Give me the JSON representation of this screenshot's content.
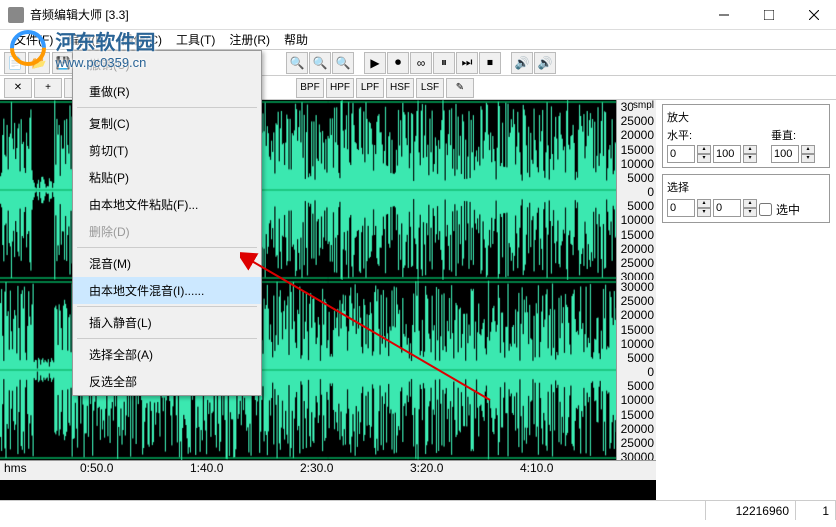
{
  "title": "音频编辑大师 [3.3]",
  "watermark": {
    "name": "河东软件园",
    "url": "www.pc0359.cn"
  },
  "menubar": [
    "文件(F)",
    "编辑(E)",
    "操作(C)",
    "工具(T)",
    "注册(R)",
    "帮助"
  ],
  "dropdown": {
    "items": [
      {
        "label": "撤销(U)",
        "disabled": true
      },
      {
        "label": "重做(R)"
      },
      {
        "sep": true
      },
      {
        "label": "复制(C)"
      },
      {
        "label": "剪切(T)"
      },
      {
        "label": "粘贴(P)"
      },
      {
        "label": "由本地文件粘贴(F)..."
      },
      {
        "label": "删除(D)",
        "disabled": true
      },
      {
        "sep": true
      },
      {
        "label": "混音(M)"
      },
      {
        "label": "由本地文件混音(I)......",
        "highlighted": true
      },
      {
        "sep": true
      },
      {
        "label": "插入静音(L)"
      },
      {
        "sep": true
      },
      {
        "label": "选择全部(A)"
      },
      {
        "label": "反选全部"
      }
    ]
  },
  "filters": [
    "BPF",
    "HPF",
    "LPF",
    "HSF",
    "LSF"
  ],
  "ruler_label": "smpl",
  "amplitude_ticks": [
    "30000",
    "25000",
    "20000",
    "15000",
    "10000",
    "5000",
    "0",
    "5000",
    "10000",
    "15000",
    "20000",
    "25000",
    "30000"
  ],
  "time_label": "hms",
  "time_ticks": [
    "0:50.0",
    "1:40.0",
    "2:30.0",
    "3:20.0",
    "4:10.0"
  ],
  "right_panel": {
    "zoom_title": "放大",
    "horiz_label": "水平:",
    "vert_label": "垂直:",
    "horiz_val1": "0",
    "horiz_val2": "100",
    "vert_val": "100",
    "select_title": "选择",
    "sel_val1": "0",
    "sel_val2": "0",
    "sel_check": "选中"
  },
  "statusbar": {
    "cell1": "",
    "cell2": "12216960",
    "cell3": "1"
  },
  "chart_data": {
    "type": "waveform",
    "channels": 2,
    "sample_format": "smpl",
    "amplitude_range": [
      -32768,
      32767
    ],
    "amplitude_tick_values": [
      30000,
      25000,
      20000,
      15000,
      10000,
      5000,
      0,
      -5000,
      -10000,
      -15000,
      -20000,
      -25000,
      -30000
    ],
    "time_unit": "hms",
    "time_range_seconds": [
      0,
      290
    ],
    "time_tick_labels": [
      "0:50.0",
      "1:40.0",
      "2:30.0",
      "3:20.0",
      "4:10.0"
    ],
    "time_tick_seconds": [
      50,
      100,
      150,
      200,
      250
    ],
    "total_samples": 12216960,
    "description": "Stereo audio waveform, dense high-amplitude signal (peaks near ±30000) across full duration with brief low-amplitude gap near start and variable density throughout."
  }
}
